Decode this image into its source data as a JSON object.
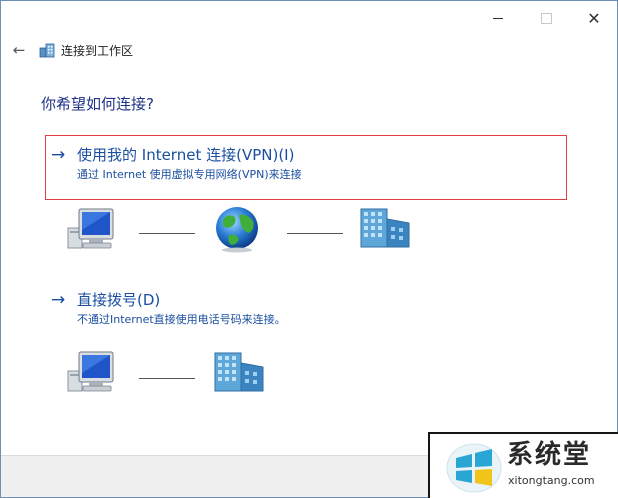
{
  "window": {
    "title": "连接到工作区",
    "controls": {
      "minimize": "—",
      "maximize": "☐",
      "close": "✕"
    }
  },
  "nav": {
    "back_glyph": "←"
  },
  "main": {
    "heading": "你希望如何连接?",
    "options": [
      {
        "arrow": "→",
        "title": "使用我的 Internet 连接(VPN)(I)",
        "description": "通过 Internet 使用虚拟专用网络(VPN)来连接",
        "icons": [
          "computer-icon",
          "globe-icon",
          "office-building-icon"
        ]
      },
      {
        "arrow": "→",
        "title": "直接拨号(D)",
        "description": "不通过Internet直接使用电话号码来连接。",
        "icons": [
          "computer-icon",
          "office-building-icon"
        ]
      }
    ]
  },
  "watermark": {
    "brand": "系统堂",
    "url": "xitongtang.com"
  },
  "colors": {
    "link": "#1a4fa0",
    "heading": "#1e3287",
    "highlight_border": "#e04040",
    "footer": "#f0f0f0"
  }
}
